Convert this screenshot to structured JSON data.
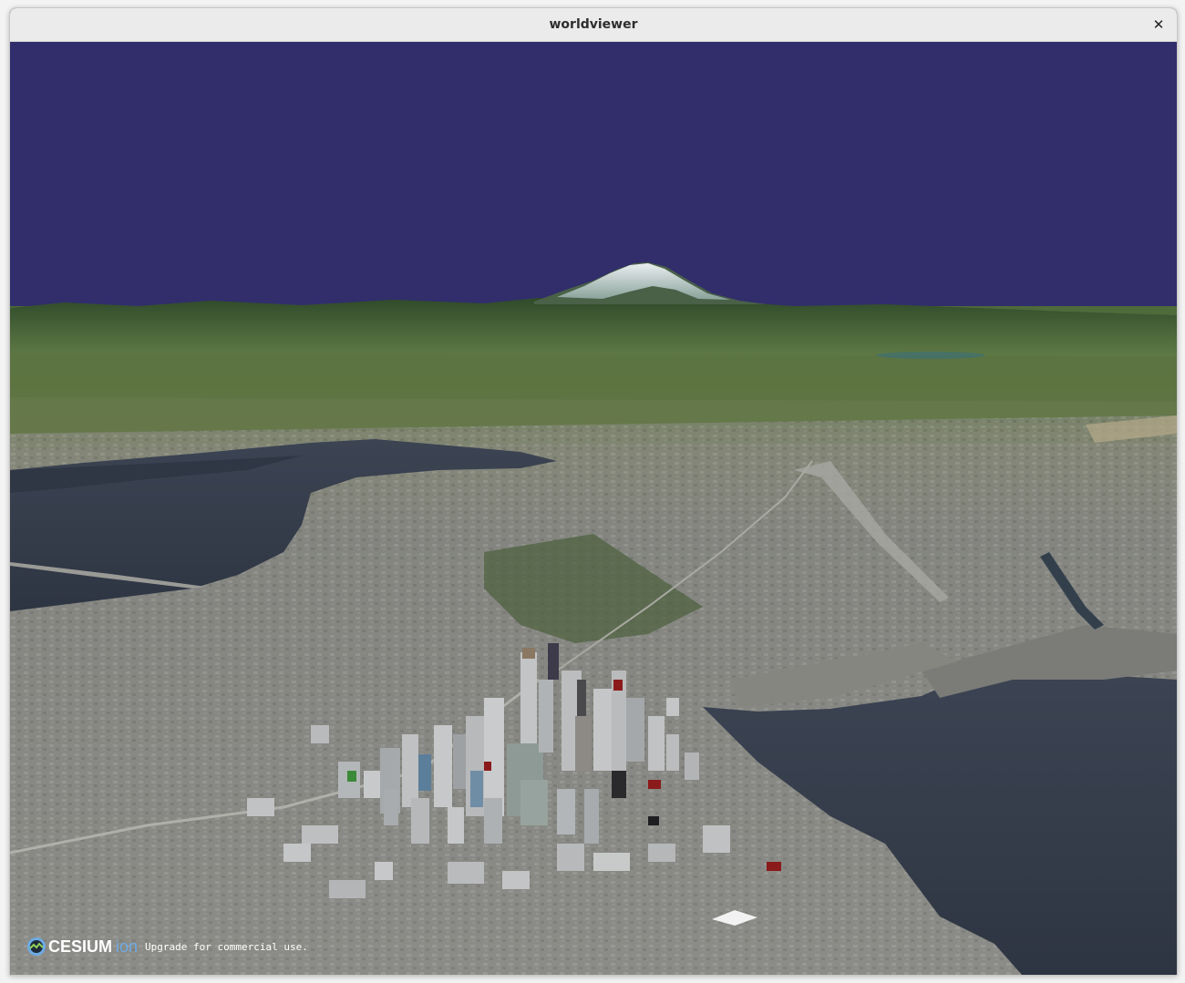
{
  "window": {
    "title": "worldviewer",
    "close_glyph": "✕"
  },
  "viewport": {
    "scene": "3D terrain view",
    "sky_color": "#312e6b"
  },
  "credits": {
    "logo_brand": "CESIUM",
    "logo_suffix": "ion",
    "logo_icon": "cesium-globe-icon",
    "message": "Upgrade for commercial use."
  }
}
